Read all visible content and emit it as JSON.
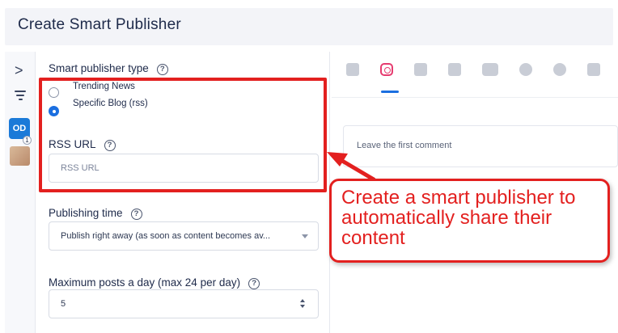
{
  "header": {
    "title": "Create Smart Publisher"
  },
  "rail": {
    "expand_glyph": ">",
    "avatar_initials": "OD",
    "avatar_count": "1"
  },
  "form": {
    "publisher_type": {
      "label": "Smart publisher type",
      "help": "?",
      "options": [
        {
          "label": "Trending News",
          "checked": false
        },
        {
          "label": "Specific Blog (rss)",
          "checked": true
        }
      ]
    },
    "rss_url": {
      "label": "RSS URL",
      "help": "?",
      "placeholder": "RSS URL"
    },
    "publishing_time": {
      "label": "Publishing time",
      "help": "?",
      "value": "Publish right away (as soon as content becomes av..."
    },
    "max_posts": {
      "label": "Maximum posts a day (max 24 per day)",
      "help": "?",
      "value": "5"
    }
  },
  "preview": {
    "tabs": [
      {
        "icon": "facebook-icon",
        "active": false
      },
      {
        "icon": "instagram-icon",
        "active": true
      },
      {
        "icon": "linkedin-icon",
        "active": false
      },
      {
        "icon": "twitter-icon",
        "active": false
      },
      {
        "icon": "youtube-icon",
        "active": false
      },
      {
        "icon": "google-icon",
        "active": false
      },
      {
        "icon": "reddit-icon",
        "active": false
      },
      {
        "icon": "vimeo-icon",
        "active": false
      }
    ],
    "comment_placeholder": "Leave the first comment"
  },
  "annotation": {
    "callout_text": "Create a smart publisher to automatically share their content",
    "color": "#e3201f"
  },
  "colors": {
    "accent": "#1b6fe0",
    "annotation": "#e3201f",
    "instagram": "#e63b6f"
  }
}
